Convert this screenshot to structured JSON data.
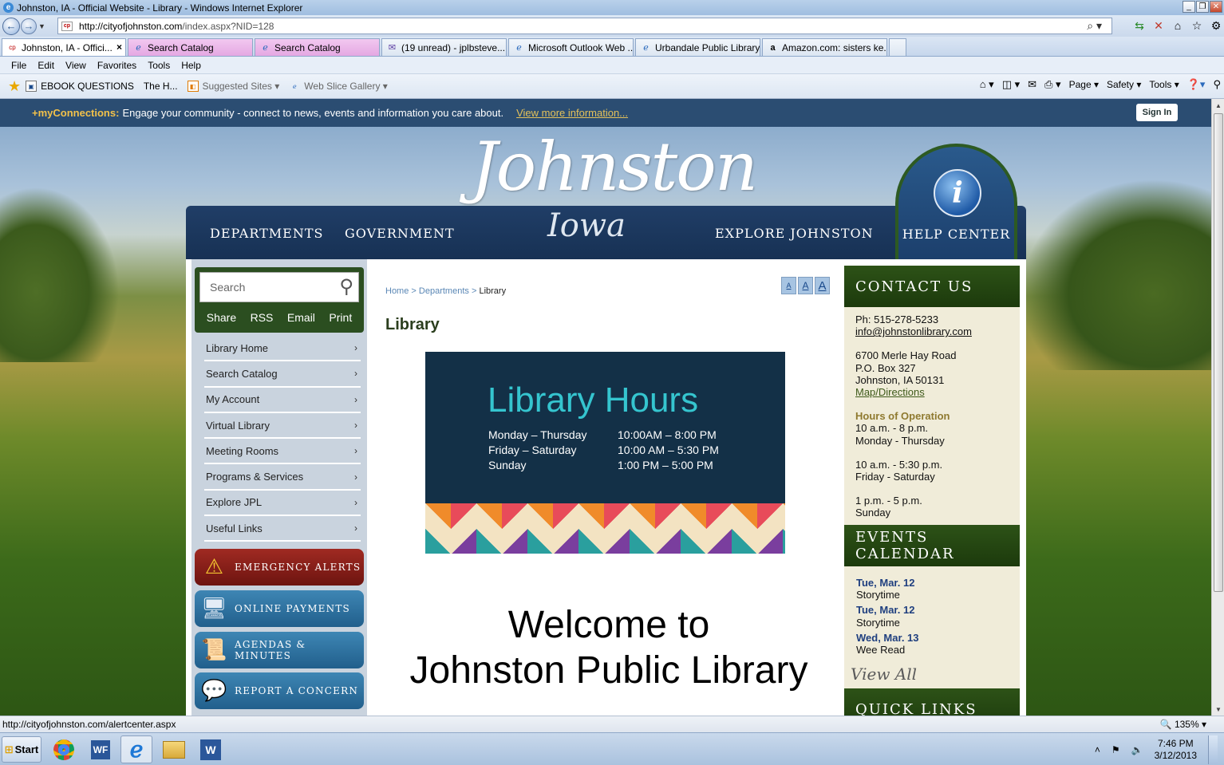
{
  "window": {
    "title": "Johnston, IA - Official Website - Library - Windows Internet Explorer",
    "minimize": "_",
    "restore": "❐",
    "close": "✕"
  },
  "address": {
    "url_host": "http://cityofjohnston.com",
    "url_path": "/index.aspx?NID=128"
  },
  "tabs": [
    {
      "label": "Johnston, IA - Offici...",
      "icon": "page-icon",
      "active": true
    },
    {
      "label": "Search Catalog",
      "icon": "ie-icon"
    },
    {
      "label": "Search Catalog",
      "icon": "ie-icon"
    },
    {
      "label": "(19 unread) - jplbsteve...",
      "icon": "mail-icon"
    },
    {
      "label": "Microsoft Outlook Web ...",
      "icon": "ie-icon"
    },
    {
      "label": "Urbandale Public Library",
      "icon": "ie-icon"
    },
    {
      "label": "Amazon.com: sisters ke...",
      "icon": "amazon-icon"
    }
  ],
  "menu": [
    "File",
    "Edit",
    "View",
    "Favorites",
    "Tools",
    "Help"
  ],
  "favorites": {
    "items": [
      "EBOOK QUESTIONS",
      "The H...",
      "Suggested Sites",
      "Web Slice Gallery"
    ],
    "commands": [
      "Page",
      "Safety",
      "Tools"
    ]
  },
  "site": {
    "myconnections_brand": "+myConnections:",
    "myconnections_text": "Engage your community - connect to news, events and information you care about.",
    "myconnections_link": "View more information...",
    "sign_in": "Sign In",
    "logo_script": "Johnston",
    "logo_sub": "Iowa",
    "nav": [
      "DEPARTMENTS",
      "GOVERNMENT",
      "EXPLORE JOHNSTON"
    ],
    "help_center": "HELP CENTER"
  },
  "left": {
    "search_placeholder": "Search",
    "share_links": [
      "Share",
      "RSS",
      "Email",
      "Print"
    ],
    "menu": [
      "Library Home",
      "Search Catalog",
      "My Account",
      "Virtual Library",
      "Meeting Rooms",
      "Programs & Services",
      "Explore JPL",
      "Useful Links"
    ],
    "buttons": [
      "EMERGENCY ALERTS",
      "ONLINE PAYMENTS",
      "AGENDAS & MINUTES",
      "REPORT A CONCERN"
    ]
  },
  "center": {
    "breadcrumb": {
      "home": "Home",
      "sep": ">",
      "departments": "Departments",
      "current": "Library"
    },
    "font_sizes": [
      "A",
      "A",
      "A"
    ],
    "title": "Library",
    "hours": {
      "heading": "Library Hours",
      "rows": [
        {
          "days": "Monday – Thursday",
          "time": "10:00AM – 8:00 PM"
        },
        {
          "days": "Friday – Saturday",
          "time": "10:00 AM – 5:30 PM"
        },
        {
          "days": "Sunday",
          "time": "1:00 PM –  5:00 PM"
        }
      ]
    },
    "welcome_line1": "Welcome to",
    "welcome_line2": "Johnston Public Library"
  },
  "right": {
    "contact_heading": "CONTACT US",
    "phone": "Ph: 515-278-5233",
    "email": "info@johnstonlibrary.com",
    "addr1": "6700 Merle Hay Road",
    "addr2": "P.O. Box 327",
    "addr3": "Johnston, IA 50131",
    "map": "Map/Directions",
    "hours_heading": "Hours of Operation",
    "hours": [
      "10 a.m. - 8 p.m.",
      "Monday - Thursday",
      "10 a.m. - 5:30 p.m.",
      "Friday - Saturday",
      "1 p.m. - 5 p.m.",
      "Sunday"
    ],
    "events_heading": "EVENTS CALENDAR",
    "events": [
      {
        "date": "Tue, Mar. 12",
        "name": "Storytime"
      },
      {
        "date": "Tue, Mar. 12",
        "name": "Storytime"
      },
      {
        "date": "Wed, Mar. 13",
        "name": "Wee Read"
      }
    ],
    "view_all": "View All",
    "quick_links_heading": "QUICK LINKS"
  },
  "status": {
    "url": "http://cityofjohnston.com/alertcenter.aspx",
    "zoom": "135%"
  },
  "taskbar": {
    "start": "Start",
    "time": "7:46 PM",
    "date": "3/12/2013"
  }
}
